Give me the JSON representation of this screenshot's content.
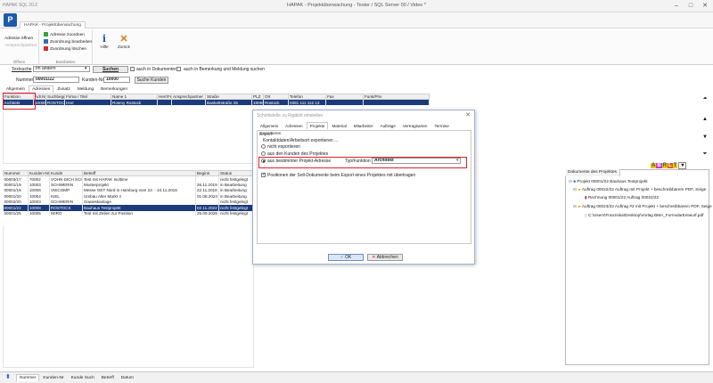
{
  "window": {
    "app_tag": "HAPAK SQL 20.2",
    "title": "HAPAK - Projektüberwachung - Tester / SQL Server 00 / Video *",
    "doc_tab": "HAPAK - Projektüberwachung"
  },
  "ribbon": {
    "offnen": {
      "item1": "Adresse öffnen",
      "item2": "Ansprechpartner",
      "label": "Öffnen"
    },
    "bearbeiten": {
      "add": "Adresse zuordnen",
      "edit": "Zuordnung bearbeiten",
      "delete": "Zuordnung löschen",
      "label": "Bearbeiten"
    },
    "hilfe": "Hilfe",
    "zurueck": "Zurück"
  },
  "search": {
    "textsuche_label": "Textsuche",
    "textsuche_value": "Im ändern",
    "suchen_button": "Suchen",
    "check_dokumente": "auch in Dokumenten",
    "check_bemerkung": "auch in Bemerkung und Meldung suchen",
    "nummer_label": "Nummer",
    "nummer_value": "00001/22",
    "kunden_label": "Kunden-Nr.",
    "kunden_value": "10000",
    "suche_kunden": "Suche Kunden"
  },
  "upper_tabs": [
    "Allgemein",
    "Adressen",
    "Zusatz",
    "Meldung",
    "Bemerkungen"
  ],
  "address_grid": {
    "columns": [
      "Funktion",
      "Adr.Nr",
      "Suchbegriff",
      "Firma / Titel",
      "Name 1",
      "Herr/Frau",
      "Ansprechpartner",
      "Straße",
      "PLZ",
      "Ort",
      "Telefon",
      "Fax",
      "Funk/Priv"
    ],
    "rows": [
      [
        "Architekt",
        "10008",
        "ROSTOCK",
        "Herr",
        "Rosmy Rostock",
        "",
        "",
        "Bankettstraße 25",
        "18055",
        "Rostock",
        "0381 111 112 13",
        "",
        ""
      ]
    ]
  },
  "project_grid": {
    "columns": [
      "Nummer",
      "Kunden-Nr",
      "Kunde",
      "Betreff",
      "Beginn",
      "Status"
    ],
    "rows": [
      [
        "00003/17",
        "70002",
        "VOHN DICH SCHI",
        "Test mit HAPAK Isoltime",
        "",
        "nicht festgelegt"
      ],
      [
        "00001/19",
        "10003",
        "SCHWERIN",
        "Musterprojekt",
        "26.11.2019",
        "in Bearbeitung"
      ],
      [
        "00001/19",
        "10006",
        "VIECOMP",
        "Messe GET Nord in Hamburg vom 22. - 24.11.2018",
        "22.11.2018",
        "in Bearbeitung"
      ],
      [
        "00001/20",
        "10004",
        "KIEL",
        "Umbau Alter Markt 4",
        "01.08.2024",
        "in Bearbeitung"
      ],
      [
        "00002/20",
        "10003",
        "SCHWERIN",
        "Sowieskanlage",
        "",
        "nicht festgelegt"
      ],
      [
        "00001/22",
        "10008",
        "ROSTOCK",
        "Bauhaus Testprojekt",
        "02.11.2022",
        "nicht festgelegt"
      ],
      [
        "00001/25",
        "10005",
        "WIRO",
        "Test mit Zeilen zur Position",
        "25.09.2025",
        "nicht festgelegt"
      ]
    ],
    "selected_index": 5
  },
  "dialog": {
    "title": "Schnittstelle zu Rigibolt einstellen",
    "close": "✕",
    "tabs": [
      "Allgemein",
      "Adressen",
      "Projekte",
      "Material",
      "Mitarbeiter",
      "Aufträge",
      "Vertragsarten",
      "Termine",
      "Exportieren"
    ],
    "active_tab": 2,
    "section_label": "Export",
    "subsection": "Kontaktdaten/Arbeitsort exportieren ...",
    "opt1": "nicht exportieren",
    "opt2": "aus den Kunden des Projektes",
    "opt3": "aus bestimmter Projekt-Adresse",
    "typ_label": "Typ/Funktion",
    "typ_value": "Architekt",
    "checkbox_label": "Positionen der Soll-Dokumente beim Export eines Projektes mit übertragen",
    "ok": "OK",
    "cancel": "Abbrechen"
  },
  "tree": {
    "tab": "Dokumente des Projektes",
    "root": "Projekt 00001/22 Bauhaus Testprojekt",
    "n1": "Auftrag 00022/22 Auftrag mit Projekt + beschreibbarem PDF, Seige",
    "n2": "Rechnung 00001/22 Auftrag 00022/22",
    "n3": "Auftrag 00023/22 Auftrag #2 mit Projekt + beschreibbarem PDF, Seige",
    "n4": "C:\\Users\\Franziska\\Desktop\\Vorlag BMA_FormularEntwurf.pdf"
  },
  "bottom_tabs": [
    "Nummer",
    "Kunden-Nr",
    "Kunde Such",
    "Betreff",
    "Datum"
  ],
  "colors": {
    "selection": "#1b3a7a",
    "highlight": "#e0202a",
    "accent": "#1e5aa8"
  }
}
